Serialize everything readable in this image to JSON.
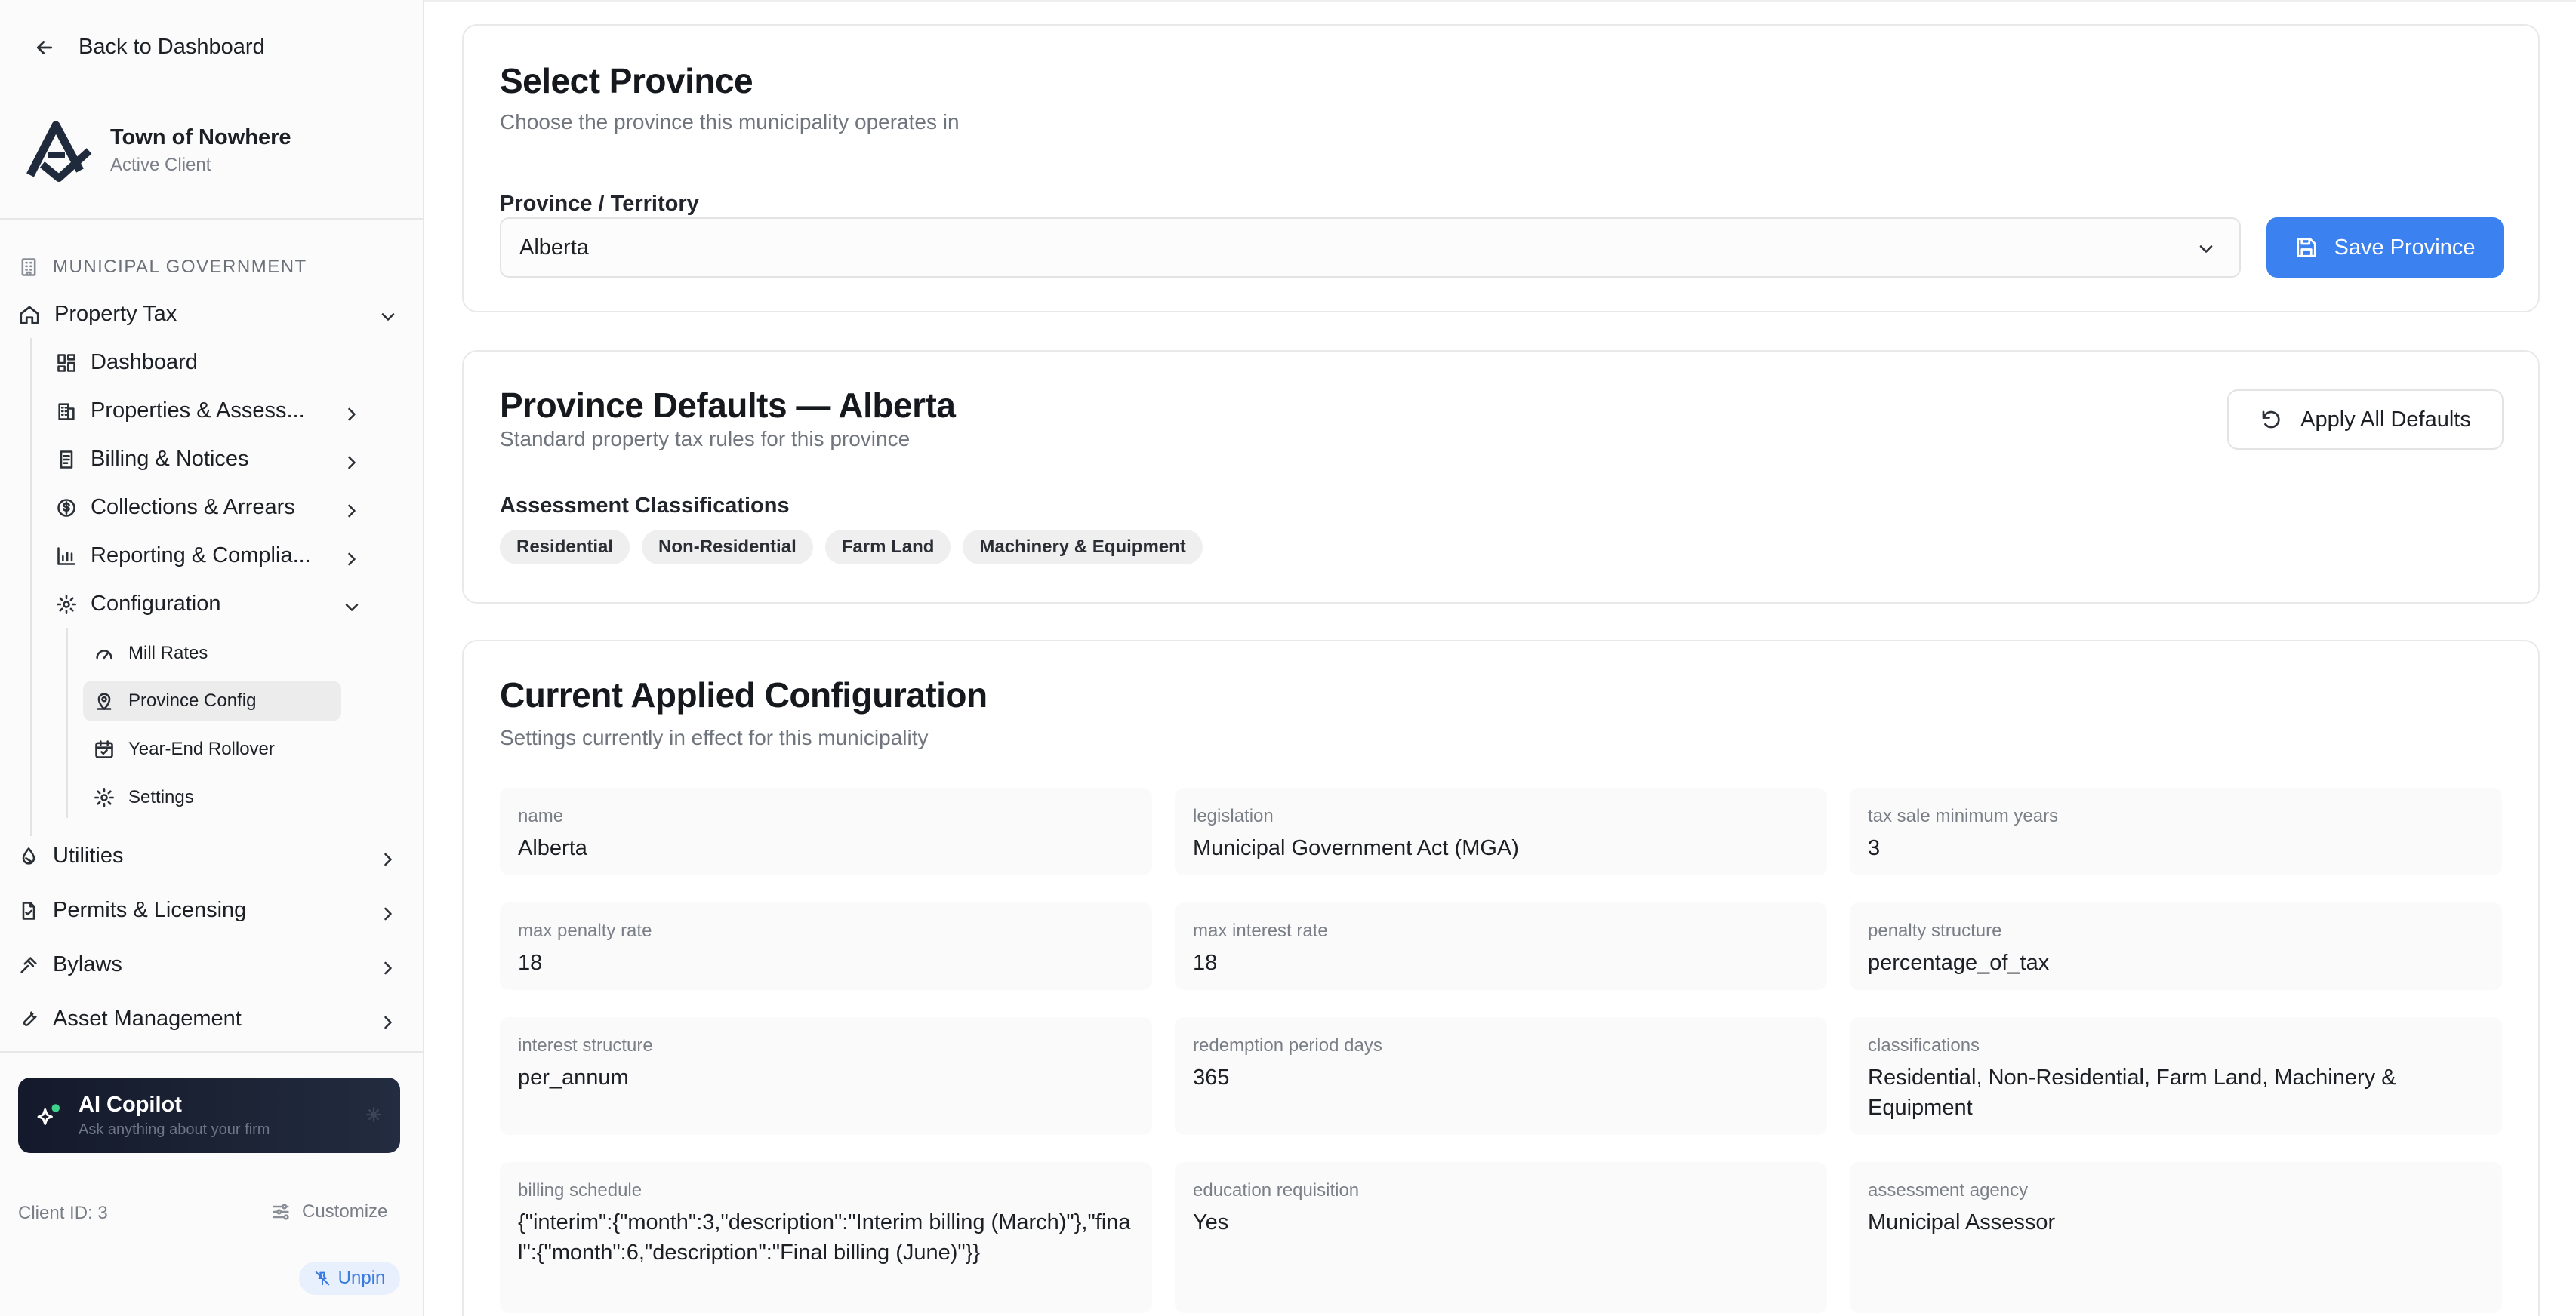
{
  "sidebar": {
    "back_label": "Back to Dashboard",
    "client": {
      "name": "Town of Nowhere",
      "status": "Active Client"
    },
    "section_label": "MUNICIPAL GOVERNMENT",
    "groups": {
      "property_tax": "Property Tax",
      "dashboard": "Dashboard",
      "properties": "Properties & Assess...",
      "billing": "Billing & Notices",
      "collections": "Collections & Arrears",
      "reporting": "Reporting & Complia...",
      "configuration": "Configuration",
      "mill_rates": "Mill Rates",
      "province_config": "Province Config",
      "year_end": "Year-End Rollover",
      "settings": "Settings",
      "utilities": "Utilities",
      "permits": "Permits & Licensing",
      "bylaws": "Bylaws",
      "assets": "Asset Management"
    },
    "copilot": {
      "title": "AI Copilot",
      "subtitle": "Ask anything about your firm"
    },
    "client_id": "Client ID: 3",
    "customize_label": "Customize",
    "unpin_label": "Unpin"
  },
  "select_province": {
    "title": "Select Province",
    "subtitle": "Choose the province this municipality operates in",
    "field_label": "Province / Territory",
    "selected_value": "Alberta",
    "save_label": "Save Province"
  },
  "defaults": {
    "title": "Province Defaults — Alberta",
    "subtitle": "Standard property tax rules for this province",
    "apply_label": "Apply All Defaults",
    "classifications_label": "Assessment Classifications",
    "classifications": [
      "Residential",
      "Non-Residential",
      "Farm Land",
      "Machinery & Equipment"
    ]
  },
  "current": {
    "title": "Current Applied Configuration",
    "subtitle": "Settings currently in effect for this municipality",
    "fields": [
      {
        "key": "name",
        "value": "Alberta"
      },
      {
        "key": "legislation",
        "value": "Municipal Government Act (MGA)"
      },
      {
        "key": "tax sale minimum years",
        "value": "3"
      },
      {
        "key": "max penalty rate",
        "value": "18"
      },
      {
        "key": "max interest rate",
        "value": "18"
      },
      {
        "key": "penalty structure",
        "value": "percentage_of_tax"
      },
      {
        "key": "interest structure",
        "value": "per_annum"
      },
      {
        "key": "redemption period days",
        "value": "365"
      },
      {
        "key": "classifications",
        "value": "Residential, Non-Residential, Farm Land, Machinery & Equipment"
      },
      {
        "key": "billing schedule",
        "value": "{\"interim\":{\"month\":3,\"description\":\"Interim billing (March)\"},\"final\":{\"month\":6,\"description\":\"Final billing (June)\"}}"
      },
      {
        "key": "education requisition",
        "value": "Yes"
      },
      {
        "key": "assessment agency",
        "value": "Municipal Assessor"
      }
    ]
  },
  "colors": {
    "primary": "#3b82f0",
    "copilot_bg": "#141a2b",
    "unpin_bg": "#e8f0fd"
  }
}
